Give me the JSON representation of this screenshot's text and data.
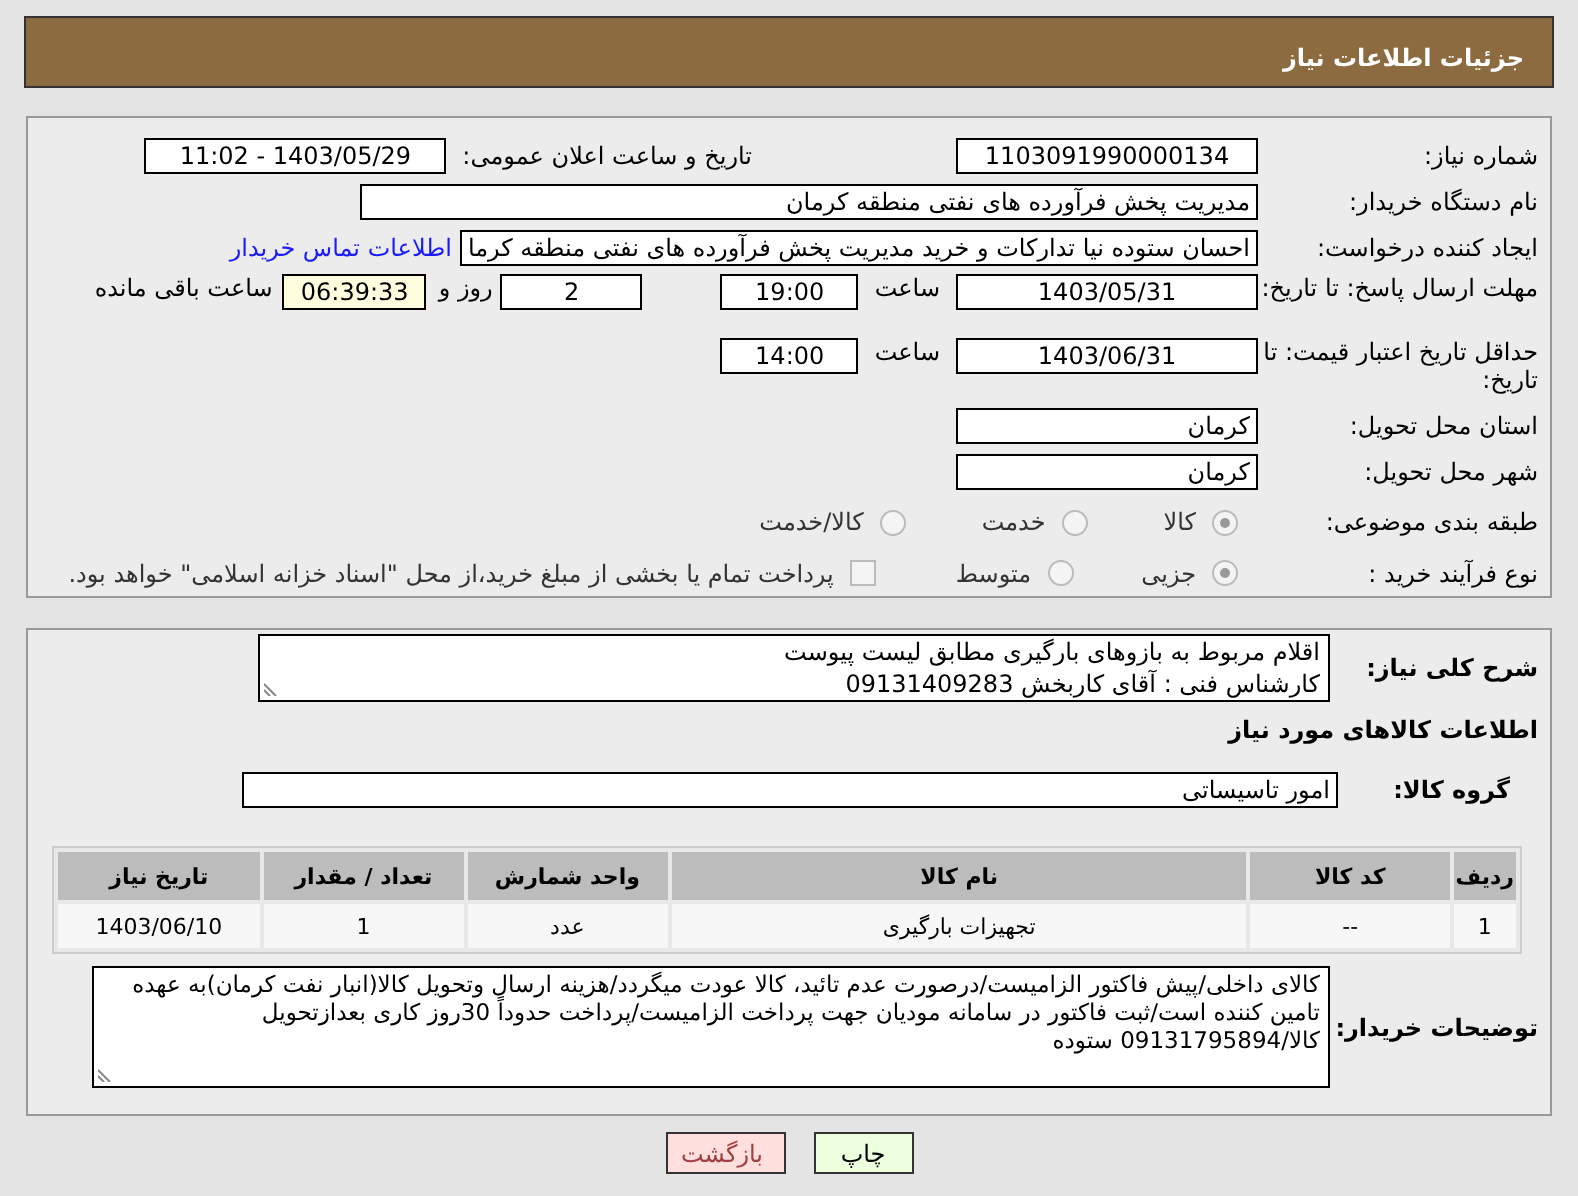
{
  "header": {
    "title": "جزئیات اطلاعات نیاز"
  },
  "details": {
    "need_number": {
      "label": "شماره نیاز:",
      "value": "1103091990000134"
    },
    "announce": {
      "label": "تاریخ و ساعت اعلان عمومی:",
      "value": "1403/05/29 - 11:02"
    },
    "buyer_org": {
      "label": "نام دستگاه خریدار:",
      "value": "مدیریت پخش فرآورده های نفتی منطقه کرمان"
    },
    "requester": {
      "label": "ایجاد کننده درخواست:",
      "value": "احسان  ستوده نیا  تدارکات و خرید  مدیریت پخش فرآورده های نفتی منطقه کرما",
      "link": "اطلاعات تماس خریدار"
    },
    "reply_deadline": {
      "label": "مهلت ارسال پاسخ: تا تاریخ:",
      "date": "1403/05/31",
      "time_label": "ساعت",
      "time": "19:00",
      "days": "2",
      "days_label": "روز و",
      "remaining": "06:39:33",
      "remaining_label": "ساعت باقی مانده"
    },
    "price_validity": {
      "label": "حداقل تاریخ اعتبار قیمت: تا تاریخ:",
      "date": "1403/06/31",
      "time_label": "ساعت",
      "time": "14:00"
    },
    "province": {
      "label": "استان محل تحویل:",
      "value": "کرمان"
    },
    "city": {
      "label": "شهر محل تحویل:",
      "value": "کرمان"
    },
    "category": {
      "label": "طبقه بندی موضوعی:",
      "options": [
        {
          "label": "کالا",
          "selected": true
        },
        {
          "label": "خدمت",
          "selected": false
        },
        {
          "label": "کالا/خدمت",
          "selected": false
        }
      ]
    },
    "purchase_process": {
      "label": "نوع فرآیند خرید :",
      "options": [
        {
          "label": "جزیی",
          "selected": true
        },
        {
          "label": "متوسط",
          "selected": false
        }
      ],
      "payment_note": {
        "checked": false,
        "text": "پرداخت تمام یا بخشی از مبلغ خرید،از محل \"اسناد خزانه اسلامی\" خواهد بود."
      }
    }
  },
  "goods": {
    "summary": {
      "label": "شرح کلی نیاز:",
      "value": "اقلام مربوط به بازوهای بارگیری مطابق لیست پیوست\nکارشناس فنی : آقای کاربخش 09131409283"
    },
    "title": "اطلاعات کالاهای مورد نیاز",
    "group": {
      "label": "گروه کالا:",
      "value": "امور تاسیساتی"
    },
    "table": {
      "columns": [
        "ردیف",
        "کد کالا",
        "نام کالا",
        "واحد شمارش",
        "تعداد / مقدار",
        "تاریخ نیاز"
      ],
      "rows": [
        [
          "1",
          "--",
          "تجهیزات بارگیری",
          "عدد",
          "1",
          "1403/06/10"
        ]
      ]
    },
    "buyer_notes": {
      "label": "توضیحات خریدار:",
      "value": "کالای داخلی/پیش فاکتور الزامیست/درصورت عدم تائید، کالا عودت میگردد/هزینه ارسال وتحویل کالا(انبار نفت کرمان)به عهده تامین کننده است/ثبت فاکتور در سامانه مودیان جهت پرداخت الزامیست/پرداخت حدوداً 30روز کاری بعدازتحویل کالا/09131795894 ستوده"
    }
  },
  "buttons": [
    {
      "label": "چاپ",
      "kind": "print"
    },
    {
      "label": "بازگشت",
      "kind": "back"
    }
  ]
}
